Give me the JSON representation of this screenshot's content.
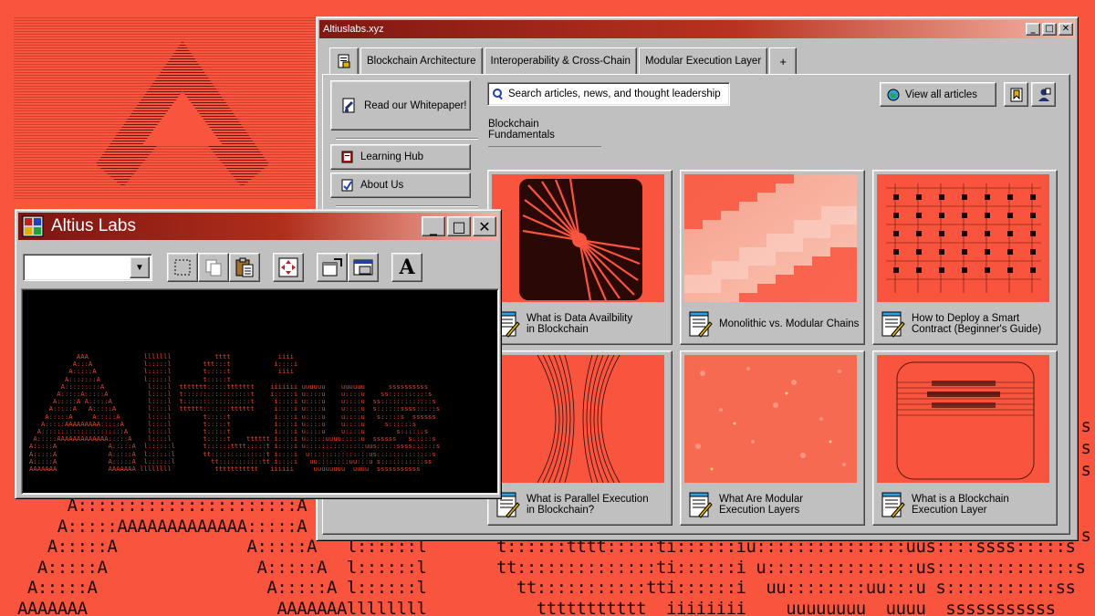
{
  "main_window": {
    "title": "Altiuslabs.xyz",
    "tabs": [
      {
        "label": "Blockchain Architecture"
      },
      {
        "label": "Interoperability & Cross-Chain"
      },
      {
        "label": "Modular Execution Layer"
      },
      {
        "label": "+"
      }
    ],
    "sidebar": {
      "whitepaper": "Read our Whitepaper!",
      "items": [
        {
          "label": "Learning Hub",
          "icon": "book-icon"
        },
        {
          "label": "About Us",
          "icon": "document-icon"
        }
      ]
    },
    "search": {
      "placeholder": "Search articles, news, and thought leadership"
    },
    "section_title": "Blockchain Fundamentals",
    "view_all": "View all articles",
    "cards": [
      {
        "line1": "What is Data Availbility",
        "line2": "in Blockchain"
      },
      {
        "line1": "Monolithic vs. Modular Chains",
        "line2": ""
      },
      {
        "line1": "How to Deploy a Smart",
        "line2": "Contract (Beginner's Guide)"
      },
      {
        "line1": "What is Parallel Execution",
        "line2": "in Blockchain?"
      },
      {
        "line1": "What Are Modular",
        "line2": "Execution Layers"
      },
      {
        "line1": "What is a Blockchain",
        "line2": "Execution Layer"
      }
    ],
    "colors": {
      "accent": "#f9553e",
      "titlebar": "#801814",
      "chrome": "#c0c0c0"
    }
  },
  "alt_window": {
    "title": "Altius Labs",
    "font_tool": "A",
    "ascii_art": "            AAA              lllllll           tttt            iiii\n           A:::A             l:::::l        ttt:::t           i::::i\n          A:::::A            l:::::l        t:::::t            iiii\n         A:::::::A           l:::::l        t:::::t\n        A:::::::::A           l::::l  ttttttt:::::ttttttt    iiiiiii uuuuuu    uuuuuu      ssssssssss\n       A:::::A:::::A          l::::l  t:::::::::::::::::t    i:::::i u::::u    u::::u    ss::::::::::s\n      A:::::A A:::::A         l::::l  t:::::::::::::::::t     i::::i u::::u    u::::u  ss:::::::::::::s\n     A:::::A   A:::::A        l::::l  tttttt:::::::tttttt     i::::i u::::u    u::::u  s::::::ssss:::::s\n    A:::::A     A:::::A       l::::l        t:::::t           i::::i u::::u    u::::u   s:::::s  ssssss\n   A:::::AAAAAAAAA:::::A      l::::l        t:::::t           i::::i u::::u    u::::u     s::::::s\n  A:::::::::::::::::::::A     l::::l        t:::::t           i::::i u::::u    u::::u        s::::::s\n A:::::AAAAAAAAAAAAA:::::A    l::::l        t:::::t    tttttt i::::i u:::::uuuu:::::u  ssssss   s:::::s\nA:::::A             A:::::A  l::::::l       t::::::tttt:::::t i::::i u:::::::::::::::uus:::::ssss::::::s\nA:::::A             A:::::A  l::::::l       tt::::::::::::::t i::::i  u:::::::::::::::us::::::::::::::s\nA:::::A             A:::::A  l::::::l         tt:::::::::::tt i::::i   uu::::::::uu:::u s:::::::::::ss\nAAAAAAA             AAAAAAA llllllll           ttttttttttt   iiiiii     uuuuuuuu  uuuu  sssssssssss"
  },
  "background": {
    "bottom_ascii": "      A::::::::::::::::::::::A\n     A:::::AAAAAAAAAAAAA:::::A\n    A:::::A             A:::::A   l::::::l       t::::::tttt:::::ti::::::iu:::::::::::::::uus::::ssss:::::s\n   A:::::A               A:::::A  l::::::l       tt::::::::::::::ti::::::i u:::::::::::::::us::::::::::::::s\n  A:::::A                 A:::::A l::::::l         tt:::::::::::tti::::::i  uu::::::::uu:::u s:::::::::::ss\n AAAAAAA                   AAAAAAAllllllll           ttttttttttt  iiiiiiii    uuuuuuuu  uuuu  sssssssssss",
    "right_ascii": "s\n:s\ns\n\n\ns"
  }
}
